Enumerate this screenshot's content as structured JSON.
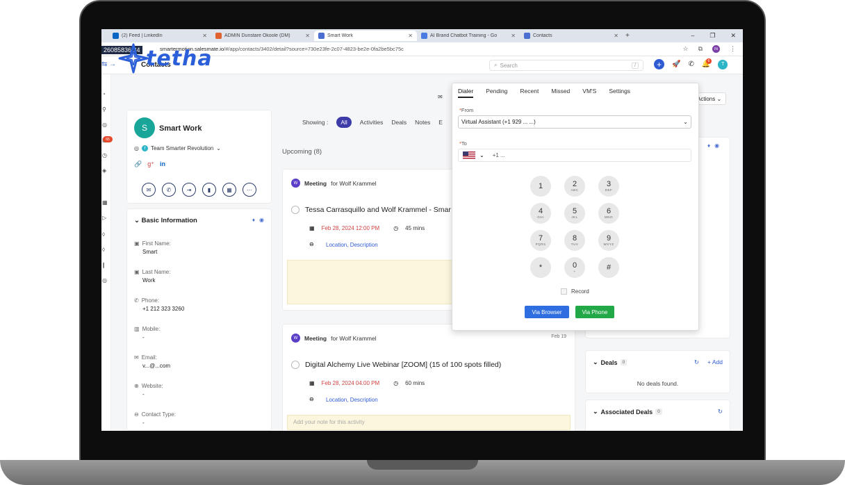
{
  "browser": {
    "tabs": [
      {
        "title": "(2) Feed | LinkedIn",
        "color": "#0a66c2"
      },
      {
        "title": "ADMIN Dunstare Okoole (DM)",
        "color": "#e0622e"
      },
      {
        "title": "Smart Work",
        "color": "#4a6fd0"
      },
      {
        "title": "AI Brand Chatbot Training - Go",
        "color": "#4a7be0"
      },
      {
        "title": "Contacts",
        "color": "#4a6fd0"
      }
    ],
    "url_host": "smartermotion.salesmate.io",
    "url_path": "/#/app/contacts/3402/detail?source=730e23fe-2c07-4823-be2e-0fa2be5bc75c",
    "profile_initials": "IN"
  },
  "overlay": {
    "phone_fragment": "26085836 34",
    "logo_word": "tetha"
  },
  "header": {
    "title": "Contacts",
    "search_placeholder": "Search",
    "search_shortcut": "/",
    "notif_count": "6",
    "user_initial": "T"
  },
  "rail": {
    "badge": "65"
  },
  "profile": {
    "initial": "S",
    "name": "Smart Work",
    "team": "Team Smarter Revolution",
    "team_initial": "T"
  },
  "basic_info": {
    "title": "Basic Information",
    "fields": [
      {
        "label": "First Name:",
        "value": "Smart",
        "icon": "text-field-icon"
      },
      {
        "label": "Last Name:",
        "value": "Work",
        "icon": "text-field-icon"
      },
      {
        "label": "Phone:",
        "value": "+1 212 323 3260",
        "icon": "phone-icon"
      },
      {
        "label": "Mobile:",
        "value": "-",
        "icon": "mobile-icon"
      },
      {
        "label": "Email:",
        "value": "v...@...com",
        "icon": "email-icon"
      },
      {
        "label": "Website:",
        "value": "-",
        "icon": "globe-icon"
      },
      {
        "label": "Contact Type:",
        "value": "-",
        "icon": "contact-type-icon"
      }
    ]
  },
  "timeline": {
    "showing_label": "Showing :",
    "filters": [
      "All",
      "Activities",
      "Deals",
      "Notes",
      "E"
    ],
    "upcoming_label": "Upcoming (8)",
    "meetings": [
      {
        "type": "Meeting",
        "with": "for Wolf Krammel",
        "date_top": "",
        "title": "Tessa Carrasquillo and Wolf Krammel - Smar",
        "date": "Feb 28, 2024 12:00 PM",
        "duration": "45 mins",
        "links": "Location, Description",
        "note": ""
      },
      {
        "type": "Meeting",
        "with": "for Wolf Krammel",
        "date_top": "Feb 19",
        "title": "Digital Alchemy Live Webinar [ZOOM] (15 of 100 spots filled)",
        "date": "Feb 28, 2024 04:00 PM",
        "duration": "60 mins",
        "links": "Location, Description",
        "note": "Add your note for this activity"
      }
    ]
  },
  "right": {
    "actions_label": "Actions",
    "deals_title": "Deals",
    "deals_count": "0",
    "deals_add": "Add",
    "deals_empty": "No deals found.",
    "assoc_title": "Associated Deals",
    "assoc_count": "0"
  },
  "dialer": {
    "tabs": [
      "Dialer",
      "Pending",
      "Recent",
      "Missed",
      "VM'S",
      "Settings"
    ],
    "from_label": "From",
    "from_value": "Virtual Assistant (+1 929 ... ...)",
    "to_label": "To",
    "to_value": "+1 ...",
    "keys": [
      {
        "n": "1",
        "s": ""
      },
      {
        "n": "2",
        "s": "ABC"
      },
      {
        "n": "3",
        "s": "DEF"
      },
      {
        "n": "4",
        "s": "GHI"
      },
      {
        "n": "5",
        "s": "JKL"
      },
      {
        "n": "6",
        "s": "MNO"
      },
      {
        "n": "7",
        "s": "PQRS"
      },
      {
        "n": "8",
        "s": "TUV"
      },
      {
        "n": "9",
        "s": "WXYZ"
      },
      {
        "n": "*",
        "s": ""
      },
      {
        "n": "0",
        "s": "+"
      },
      {
        "n": "#",
        "s": ""
      }
    ],
    "record_label": "Record",
    "via_browser": "Via Browser",
    "via_phone": "Via Phone"
  }
}
